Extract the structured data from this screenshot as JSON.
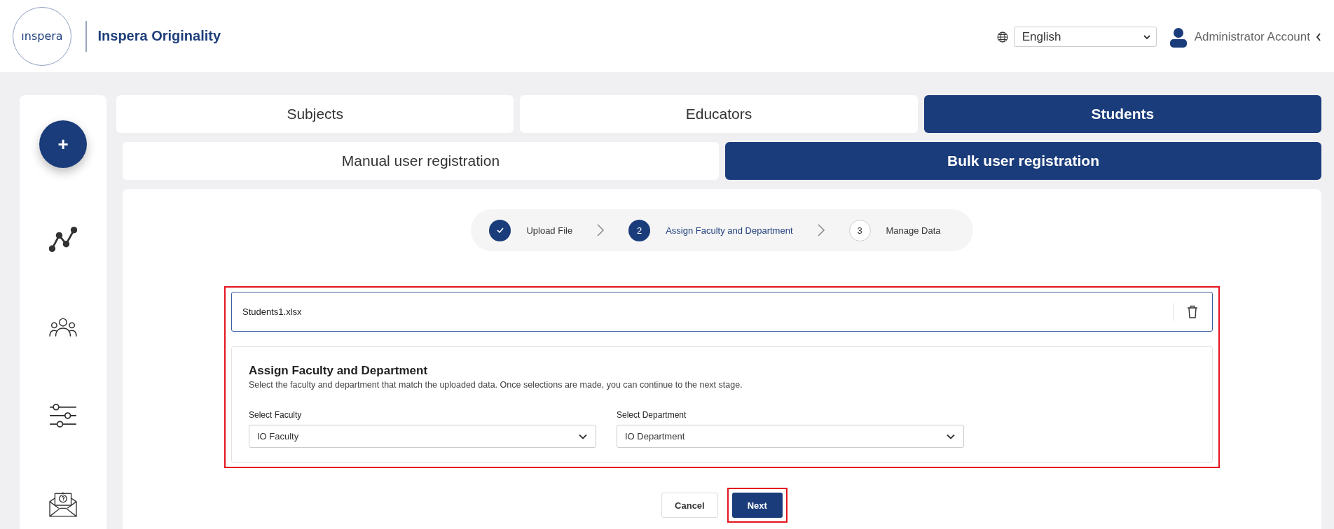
{
  "header": {
    "logo_text": "ınspera",
    "app_name": "Inspera Originality",
    "language": {
      "value": "English"
    },
    "user": {
      "name": "Administrator Account"
    }
  },
  "sidebar": {
    "items": [
      {
        "kind": "add",
        "label": "+"
      },
      {
        "kind": "chart"
      },
      {
        "kind": "people"
      },
      {
        "kind": "sliders"
      },
      {
        "kind": "mail"
      }
    ]
  },
  "tabs": [
    {
      "label": "Subjects",
      "selected": false
    },
    {
      "label": "Educators",
      "selected": false
    },
    {
      "label": "Students",
      "selected": true
    }
  ],
  "subtabs": [
    {
      "label": "Manual user registration",
      "selected": false
    },
    {
      "label": "Bulk user registration",
      "selected": true
    }
  ],
  "stepper": [
    {
      "label": "Upload File",
      "completed": true,
      "selected": false
    },
    {
      "number": "2",
      "label": "Assign Faculty and Department",
      "completed": false,
      "selected": true
    },
    {
      "number": "3",
      "label": "Manage Data",
      "completed": false,
      "selected": false
    }
  ],
  "form": {
    "highlighted": true,
    "file": {
      "name": "Students1.xlsx"
    },
    "title": "Assign Faculty and Department",
    "description": "Select the faculty and department that match the uploaded data. Once selections are made, you can continue to the next stage.",
    "fields": [
      {
        "label": "Select Faculty",
        "value": "IO Faculty"
      },
      {
        "label": "Select Department",
        "value": "IO Department"
      }
    ]
  },
  "buttons": [
    {
      "label": "Cancel",
      "kind": "secondary",
      "highlighted": false
    },
    {
      "label": "Next",
      "kind": "primary",
      "highlighted": true
    }
  ]
}
